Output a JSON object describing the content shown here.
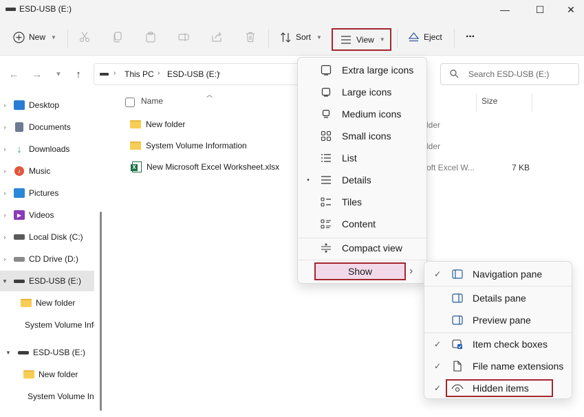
{
  "window": {
    "title": "ESD-USB (E:)",
    "minimize": "—",
    "maximize": "☐",
    "close": "✕"
  },
  "toolbar": {
    "new_label": "New",
    "sort_label": "Sort",
    "view_label": "View",
    "eject_label": "Eject",
    "more_label": "···"
  },
  "address": {
    "crumbs": [
      "This PC",
      "ESD-USB (E:)"
    ],
    "separator": "›"
  },
  "search": {
    "placeholder": "Search ESD-USB (E:)"
  },
  "sidebar": {
    "items": [
      {
        "label": "Desktop",
        "icon": "desktop-icon",
        "color": "#2b7cd3"
      },
      {
        "label": "Documents",
        "icon": "documents-icon",
        "color": "#6b7b93"
      },
      {
        "label": "Downloads",
        "icon": "downloads-icon",
        "color": "#1aa260"
      },
      {
        "label": "Music",
        "icon": "music-icon",
        "color": "#e0573d"
      },
      {
        "label": "Pictures",
        "icon": "pictures-icon",
        "color": "#2b88d8"
      },
      {
        "label": "Videos",
        "icon": "videos-icon",
        "color": "#8a3ab9"
      },
      {
        "label": "Local Disk (C:)",
        "icon": "local-disk-icon",
        "color": "#555555"
      },
      {
        "label": "CD Drive (D:)",
        "icon": "cd-drive-icon",
        "color": "#777777"
      },
      {
        "label": "ESD-USB (E:)",
        "icon": "usb-drive-icon",
        "color": "#3c3c3c"
      },
      {
        "label": "New folder",
        "icon": "folder-icon"
      },
      {
        "label": "System Volume Information",
        "icon": "folder-icon"
      },
      {
        "label": "ESD-USB (E:)",
        "icon": "usb-drive-icon",
        "color": "#3c3c3c"
      },
      {
        "label": "New folder",
        "icon": "folder-icon"
      },
      {
        "label": "System Volume Information",
        "icon": "folder-icon"
      }
    ]
  },
  "file_list": {
    "columns": {
      "name": "Name",
      "size": "Size"
    },
    "rows": [
      {
        "name": "New folder",
        "type_fragment": "lder",
        "size": ""
      },
      {
        "name": "System Volume Information",
        "type_fragment": "lder",
        "size": ""
      },
      {
        "name": "New Microsoft Excel Worksheet.xlsx",
        "type_fragment": "oft Excel W...",
        "size": "7 KB"
      }
    ]
  },
  "view_menu": {
    "items": [
      {
        "label": "Extra large icons",
        "icon": "extra-large-icons-icon"
      },
      {
        "label": "Large icons",
        "icon": "large-icons-icon"
      },
      {
        "label": "Medium icons",
        "icon": "medium-icons-icon"
      },
      {
        "label": "Small icons",
        "icon": "small-icons-icon"
      },
      {
        "label": "List",
        "icon": "list-icon"
      },
      {
        "label": "Details",
        "icon": "details-icon",
        "selected": true
      },
      {
        "label": "Tiles",
        "icon": "tiles-icon"
      },
      {
        "label": "Content",
        "icon": "content-icon"
      }
    ],
    "compact_label": "Compact view",
    "show_label": "Show",
    "bullet": "•",
    "submenu_arrow": "›"
  },
  "show_submenu": {
    "check_glyph": "✓",
    "items": [
      {
        "label": "Navigation pane",
        "checked": true,
        "icon": "navigation-pane-icon"
      },
      {
        "label": "Details pane",
        "checked": false,
        "icon": "details-pane-icon"
      },
      {
        "label": "Preview pane",
        "checked": false,
        "icon": "preview-pane-icon"
      },
      {
        "label": "Item check boxes",
        "checked": true,
        "icon": "item-check-boxes-icon"
      },
      {
        "label": "File name extensions",
        "checked": true,
        "icon": "file-name-extensions-icon"
      },
      {
        "label": "Hidden items",
        "checked": true,
        "icon": "hidden-items-icon"
      }
    ]
  },
  "colors": {
    "highlight_border": "#a4262c",
    "show_highlight": "#f2d9ea",
    "folder": "#f7cd55",
    "excel": "#1d6f42"
  }
}
